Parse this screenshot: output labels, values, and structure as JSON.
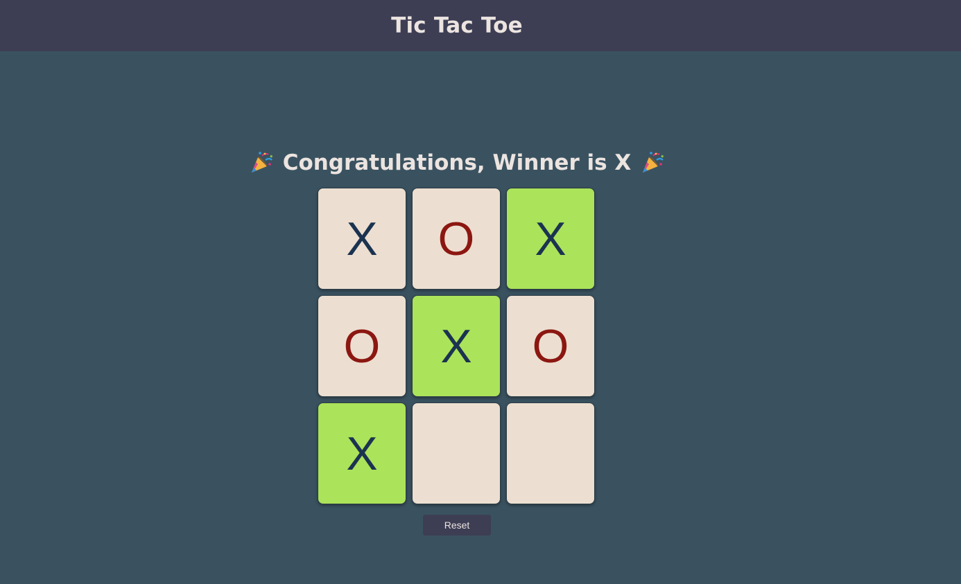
{
  "header": {
    "title": "Tic Tac Toe"
  },
  "status": {
    "text": "Congratulations, Winner is X",
    "leading_icon": "party-popper-icon",
    "trailing_icon": "party-popper-icon"
  },
  "board": {
    "cells": [
      {
        "mark": "X",
        "winning": false
      },
      {
        "mark": "O",
        "winning": false
      },
      {
        "mark": "X",
        "winning": true
      },
      {
        "mark": "O",
        "winning": false
      },
      {
        "mark": "X",
        "winning": true
      },
      {
        "mark": "O",
        "winning": false
      },
      {
        "mark": "X",
        "winning": true
      },
      {
        "mark": "",
        "winning": false
      },
      {
        "mark": "",
        "winning": false
      }
    ]
  },
  "controls": {
    "reset_label": "Reset"
  },
  "colors": {
    "page_background": "#3a5260",
    "header_background": "#3d3e54",
    "cell_background": "#ecdfd1",
    "winning_cell_background": "#abe35a",
    "x_mark": "#1b3350",
    "o_mark": "#8c1711",
    "light_text": "#ece4e0"
  }
}
